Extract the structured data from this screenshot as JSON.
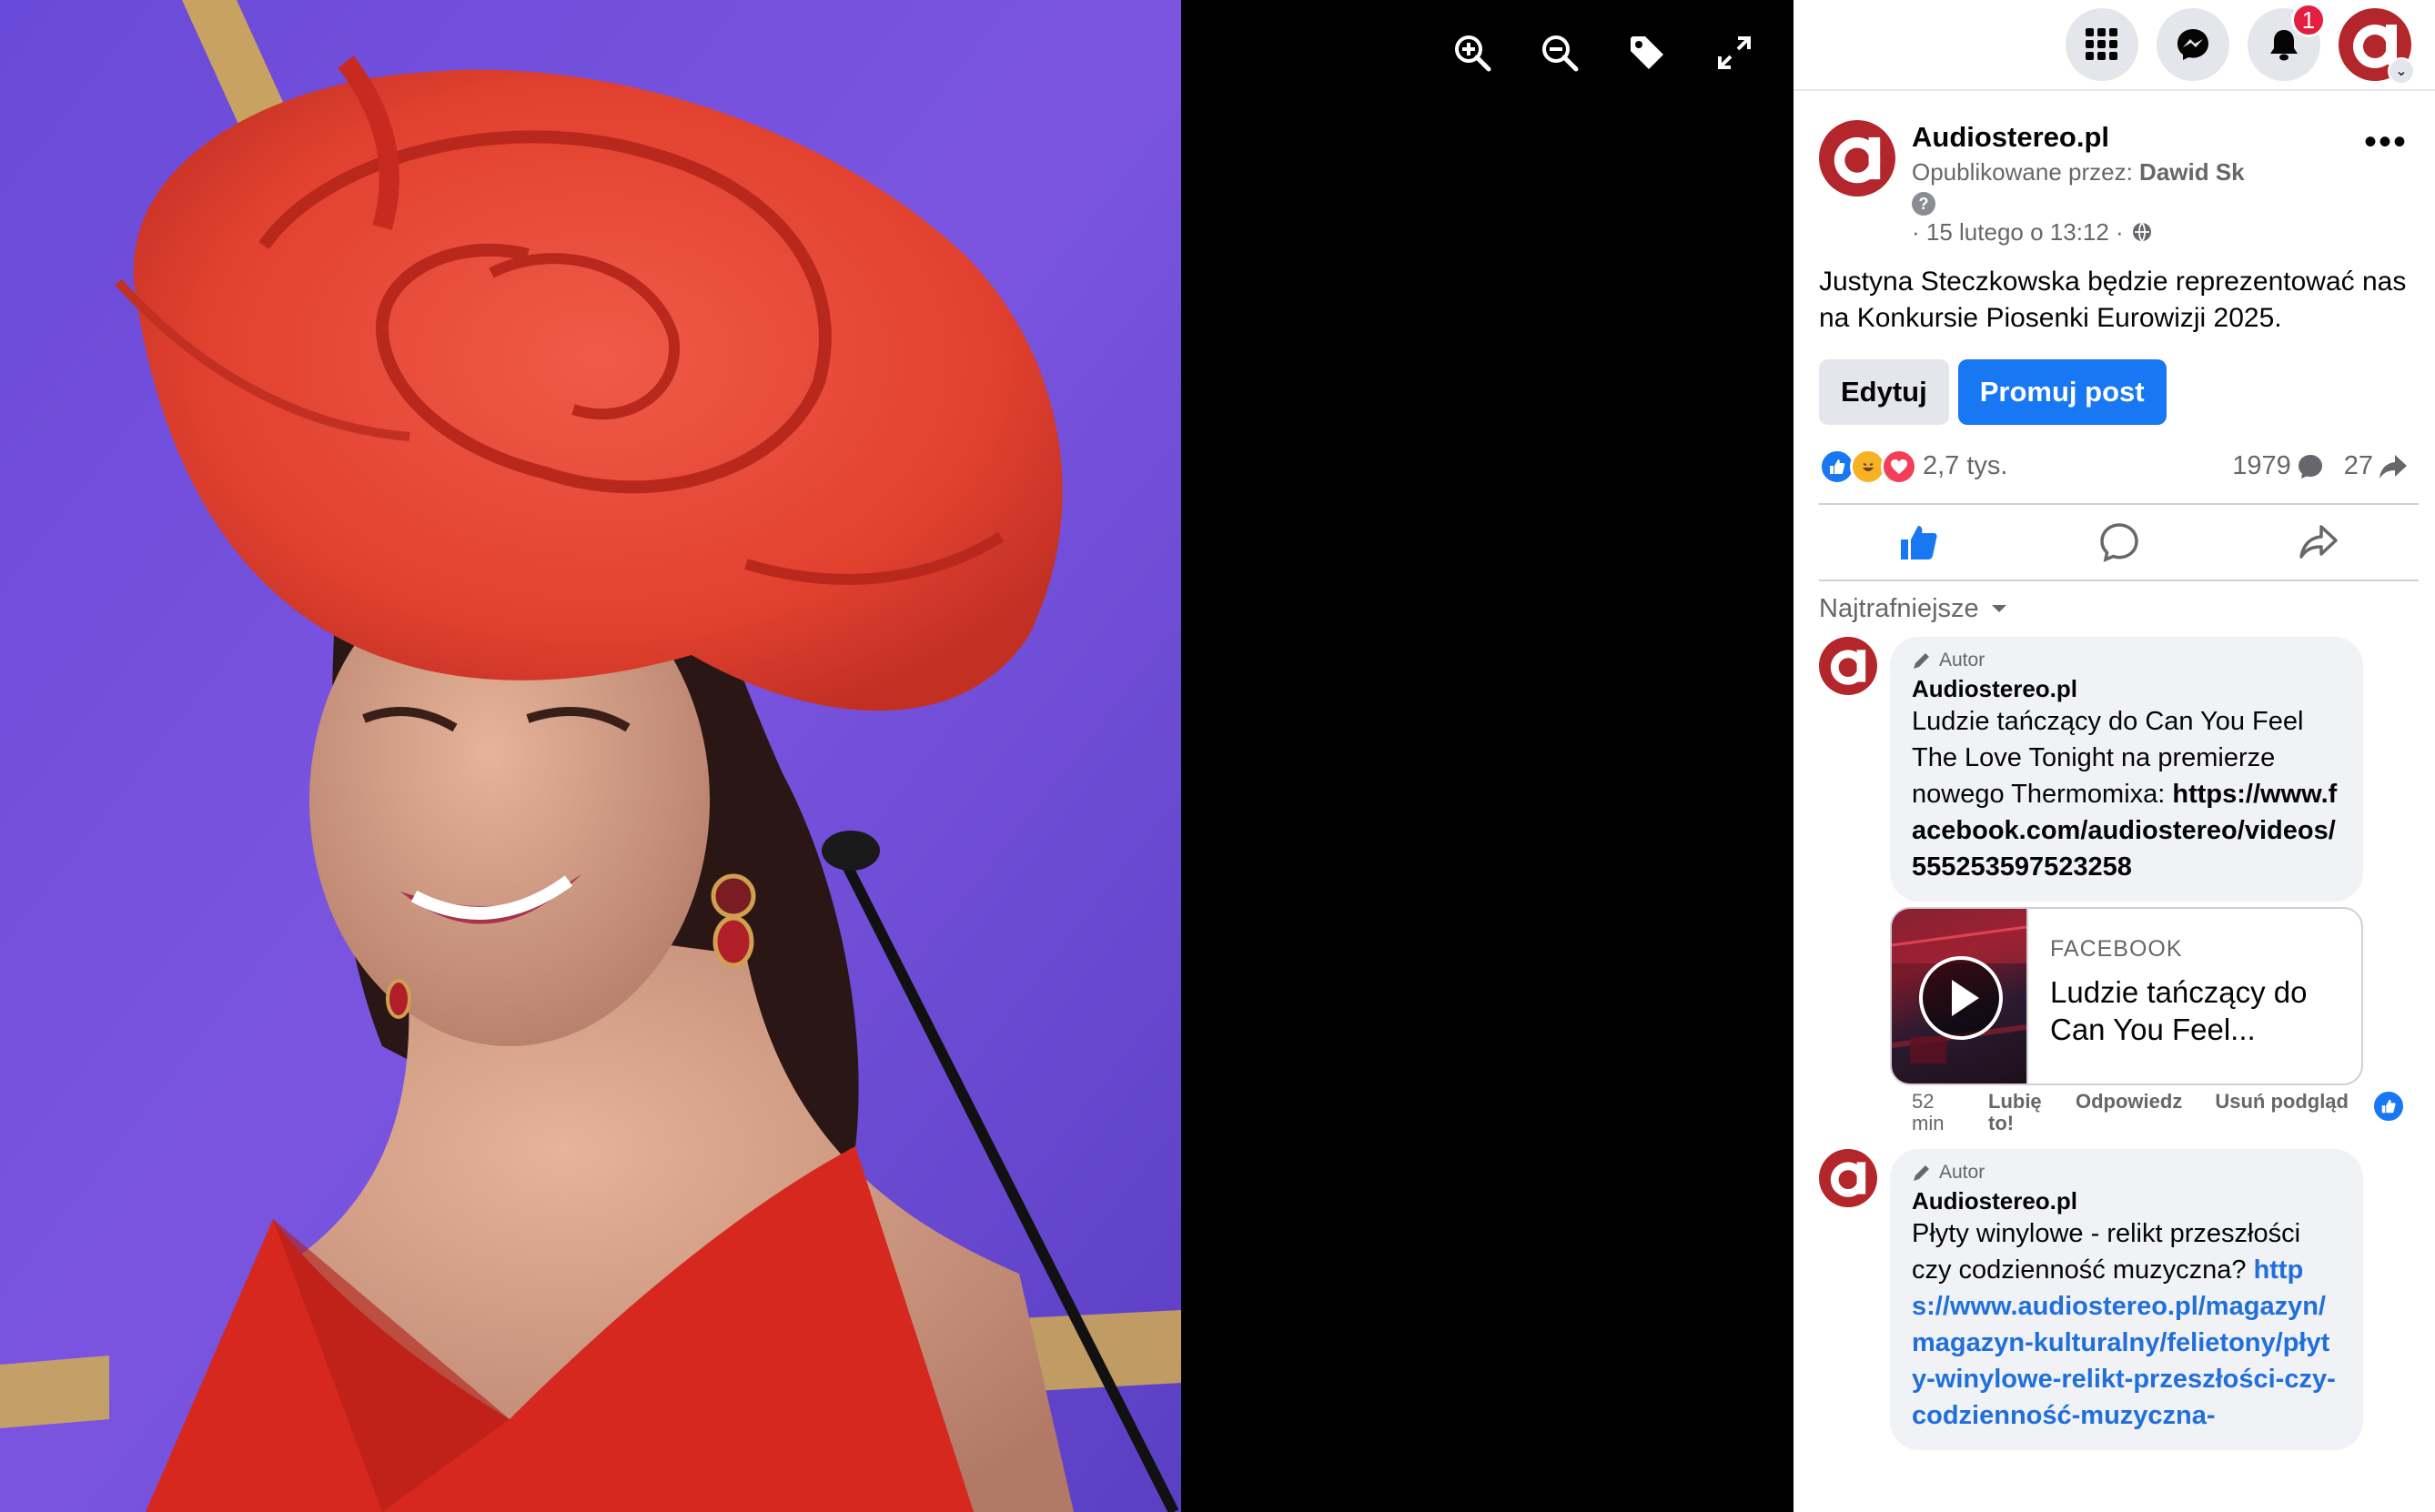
{
  "viewer": {
    "tools": [
      {
        "name": "zoom-in-icon"
      },
      {
        "name": "zoom-out-icon"
      },
      {
        "name": "tag-icon"
      },
      {
        "name": "fullscreen-icon"
      }
    ]
  },
  "topbar": {
    "notification_count": "1",
    "icons": [
      "menu-grid-icon",
      "messenger-icon",
      "bell-icon",
      "profile-avatar"
    ]
  },
  "post": {
    "page_name": "Audiostereo.pl",
    "published_by_label": "Opublikowane przez:",
    "published_by_name": "Dawid Sk",
    "help_glyph": "?",
    "date": "· 15 lutego o 13:12 ·",
    "more_glyph": "•••",
    "text": "Justyna Steczkowska będzie reprezentować nas na Konkursie Piosenki Eurowizji 2025.",
    "edit_label": "Edytuj",
    "promote_label": "Promuj post",
    "reaction_count": "2,7 tys.",
    "comment_count": "1979",
    "share_count": "27"
  },
  "comments": {
    "sort_label": "Najtrafniejsze",
    "items": [
      {
        "author_tag": "Autor",
        "name": "Audiostereo.pl",
        "text": "Ludzie tańczący do Can You Feel The Love Tonight na premierze nowego Thermomixa:",
        "link": "https://www.facebook.com/audiostereo/videos/555253597523258",
        "preview_source": "FACEBOOK",
        "preview_title": "Ludzie tańczący do Can You Feel...",
        "time": "52 min",
        "like_label": "Lubię to!",
        "reply_label": "Odpowiedz",
        "remove_preview_label": "Usuń podgląd"
      },
      {
        "author_tag": "Autor",
        "name": "Audiostereo.pl",
        "text": "Płyty winylowe - relikt przeszłości czy codzienność muzyczna?",
        "link": "https://www.audiostereo.pl/magazyn/magazyn-kulturalny/felietony/płyty-winylowe-relikt-przeszłości-czy-codzienność-muzyczna-"
      }
    ]
  },
  "colors": {
    "accent_blue": "#1877f2",
    "brand_red": "#b3262b",
    "badge_red": "#e41e3f"
  }
}
